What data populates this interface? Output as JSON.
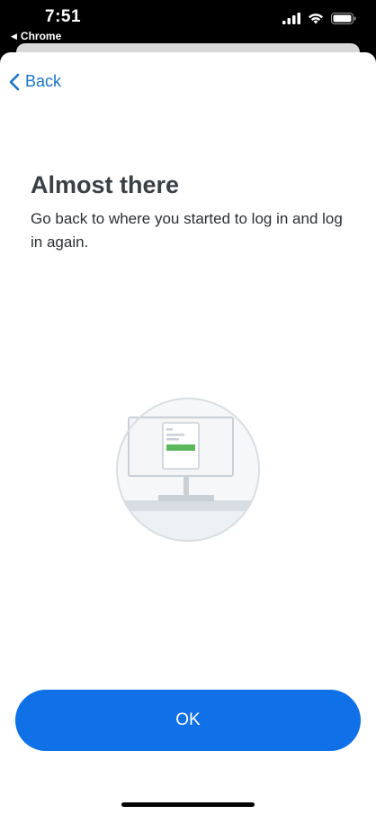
{
  "status_bar": {
    "time": "7:51",
    "back_app": "Chrome"
  },
  "nav": {
    "back_label": "Back"
  },
  "main": {
    "title": "Almost there",
    "subtitle": "Go back to where you started to log in and log in again."
  },
  "actions": {
    "ok_label": "OK"
  },
  "colors": {
    "accent": "#1070e8",
    "link": "#1a73c9",
    "illustration_green": "#5cb85c"
  },
  "icons": {
    "back": "chevron-left-icon",
    "signal": "cellular-signal-icon",
    "wifi": "wifi-icon",
    "battery": "battery-icon",
    "illustration": "computer-monitor-illustration"
  }
}
